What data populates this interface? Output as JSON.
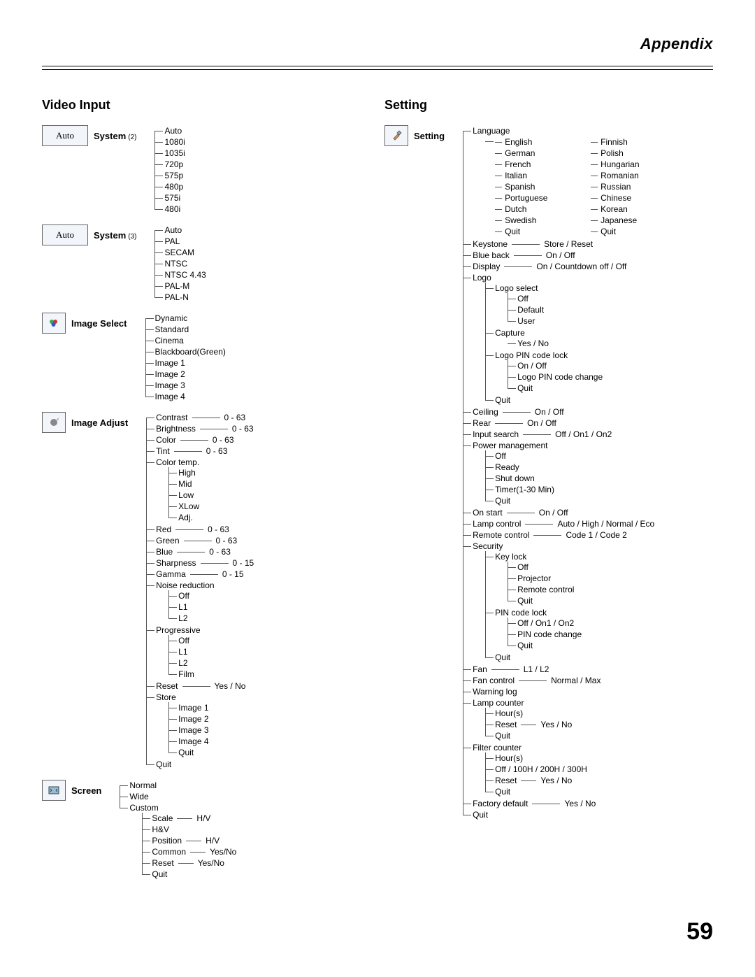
{
  "page_title": "Appendix",
  "page_number": "59",
  "column_left_title": "Video Input",
  "column_right_title": "Setting",
  "auto_label": "Auto",
  "video_input": {
    "system2": {
      "label": "System",
      "note": "(2)",
      "items": [
        "Auto",
        "1080i",
        "1035i",
        "720p",
        "575p",
        "480p",
        "575i",
        "480i"
      ]
    },
    "system3": {
      "label": "System",
      "note": "(3)",
      "items": [
        "Auto",
        "PAL",
        "SECAM",
        "NTSC",
        "NTSC 4.43",
        "PAL-M",
        "PAL-N"
      ]
    },
    "image_select": {
      "label": "Image Select",
      "items": [
        "Dynamic",
        "Standard",
        "Cinema",
        "Blackboard(Green)",
        "Image 1",
        "Image 2",
        "Image 3",
        "Image 4"
      ]
    },
    "image_adjust": {
      "label": "Image Adjust",
      "simple_ranges": [
        {
          "label": "Contrast",
          "val": "0 - 63"
        },
        {
          "label": "Brightness",
          "val": "0 - 63"
        },
        {
          "label": "Color",
          "val": "0 - 63"
        },
        {
          "label": "Tint",
          "val": "0 - 63"
        }
      ],
      "color_temp": {
        "label": "Color temp.",
        "items": [
          "High",
          "Mid",
          "Low",
          "XLow",
          "Adj."
        ]
      },
      "rgb_ranges": [
        {
          "label": "Red",
          "val": "0 - 63"
        },
        {
          "label": "Green",
          "val": "0 - 63"
        },
        {
          "label": "Blue",
          "val": "0 - 63"
        },
        {
          "label": "Sharpness",
          "val": "0 - 15"
        },
        {
          "label": "Gamma",
          "val": "0 - 15"
        }
      ],
      "noise_reduction": {
        "label": "Noise reduction",
        "items": [
          "Off",
          "L1",
          "L2"
        ]
      },
      "progressive": {
        "label": "Progressive",
        "items": [
          "Off",
          "L1",
          "L2",
          "Film"
        ]
      },
      "reset": {
        "label": "Reset",
        "val": "Yes / No"
      },
      "store": {
        "label": "Store",
        "items": [
          "Image 1",
          "Image 2",
          "Image 3",
          "Image 4",
          "Quit"
        ]
      },
      "quit": {
        "label": "Quit"
      }
    },
    "screen": {
      "label": "Screen",
      "items": [
        "Normal",
        "Wide"
      ],
      "custom": {
        "label": "Custom",
        "children": [
          {
            "label": "Scale",
            "val": "H/V"
          },
          {
            "label": "H&V"
          },
          {
            "label": "Position",
            "val": "H/V"
          },
          {
            "label": "Common",
            "val": "Yes/No"
          },
          {
            "label": "Reset",
            "val": "Yes/No"
          },
          {
            "label": "Quit"
          }
        ]
      }
    }
  },
  "setting": {
    "label": "Setting",
    "language": {
      "label": "Language",
      "left": [
        "English",
        "German",
        "French",
        "Italian",
        "Spanish",
        "Portuguese",
        "Dutch",
        "Swedish",
        "Quit"
      ],
      "right": [
        "Finnish",
        "Polish",
        "Hungarian",
        "Romanian",
        "Russian",
        "Chinese",
        "Korean",
        "Japanese",
        "Quit"
      ]
    },
    "keystone": {
      "label": "Keystone",
      "val": "Store / Reset"
    },
    "blue_back": {
      "label": "Blue back",
      "val": "On / Off"
    },
    "display": {
      "label": "Display",
      "val": "On / Countdown off / Off"
    },
    "logo": {
      "label": "Logo",
      "logo_select": {
        "label": "Logo select",
        "items": [
          "Off",
          "Default",
          "User"
        ]
      },
      "capture": {
        "label": "Capture",
        "items": [
          "Yes / No"
        ]
      },
      "logo_pin": {
        "label": "Logo PIN code lock",
        "items": [
          "On / Off",
          "Logo PIN code change",
          "Quit"
        ]
      },
      "quit": "Quit"
    },
    "ceiling": {
      "label": "Ceiling",
      "val": "On / Off"
    },
    "rear": {
      "label": "Rear",
      "val": "On / Off"
    },
    "input_search": {
      "label": "Input search",
      "val": "Off / On1 / On2"
    },
    "power_mgmt": {
      "label": "Power management",
      "items": [
        "Off",
        "Ready",
        "Shut down",
        "Timer(1-30 Min)",
        "Quit"
      ]
    },
    "on_start": {
      "label": "On start",
      "val": "On / Off"
    },
    "lamp_control": {
      "label": "Lamp control",
      "val": "Auto / High / Normal / Eco"
    },
    "remote_control": {
      "label": "Remote control",
      "val": "Code 1 / Code 2"
    },
    "security": {
      "label": "Security",
      "key_lock": {
        "label": "Key lock",
        "items": [
          "Off",
          "Projector",
          "Remote control",
          "Quit"
        ]
      },
      "pin_lock": {
        "label": "PIN code lock",
        "items": [
          "Off / On1 / On2",
          "PIN code change",
          "Quit"
        ]
      },
      "quit": "Quit"
    },
    "fan": {
      "label": "Fan",
      "val": "L1 / L2"
    },
    "fan_control": {
      "label": "Fan control",
      "val": "Normal / Max"
    },
    "warning": {
      "label": "Warning log"
    },
    "lamp_counter": {
      "label": "Lamp counter",
      "children": [
        {
          "label": "Hour(s)"
        },
        {
          "label": "Reset",
          "val": "Yes / No"
        },
        {
          "label": "Quit"
        }
      ]
    },
    "filter_counter": {
      "label": "Filter counter",
      "children": [
        {
          "label": "Hour(s)"
        },
        {
          "label": "Off / 100H / 200H / 300H"
        },
        {
          "label": "Reset",
          "val": "Yes / No"
        },
        {
          "label": "Quit"
        }
      ]
    },
    "factory": {
      "label": "Factory default",
      "val": "Yes / No"
    },
    "quit": "Quit"
  }
}
